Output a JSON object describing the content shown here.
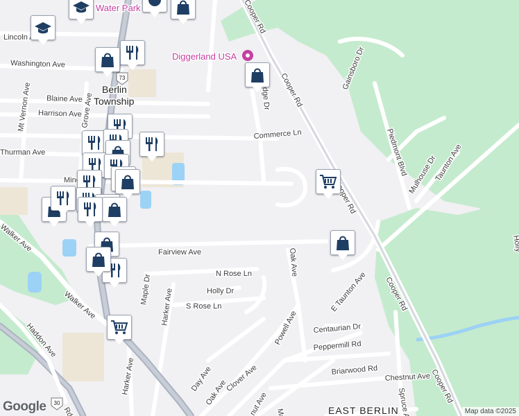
{
  "map": {
    "water_park_label": "Water Park",
    "poi_diggerland": "Diggerland USA",
    "place_berlin": [
      "Berlin",
      "Township"
    ],
    "place_east_berlin": "EAST BERLIN",
    "route_73": "73",
    "route_30": "30",
    "streets": {
      "lincoln": "Lincoln Ave",
      "washington": "Washington Ave",
      "blaine": "Blaine Ave",
      "harrison": "Harrison Ave",
      "mt_vernon": "Mt Vernon Ave",
      "grove": "Grove Ave",
      "thurman": "Thurman Ave",
      "minc": "Minc",
      "walker1": "Walker Ave",
      "walker2": "Walker Ave",
      "haddon": "Haddon Ave",
      "fairview": "Fairview Ave",
      "n_rose": "N Rose Ln",
      "holly": "Holly Dr",
      "s_rose": "S Rose Ln",
      "maple": "Maple Dr",
      "harker1": "Harker Ave",
      "harker2": "Harker Ave",
      "oak1": "Oak Ave",
      "oak2": "Oak Ave",
      "powell": "Powell Ave",
      "day": "Day Ave",
      "clover": "Clover Ave",
      "chestnut_partial": "nut Ave",
      "ma_partial": "Ma",
      "commerce": "Commerce Ln",
      "edge_partial": "edge Dr",
      "cooper1": "Cooper Rd",
      "cooper2": "Cooper Rd",
      "cooper3": "Cooper Rd",
      "cooper4": "Cooper Rd",
      "cooper5": "Cooper Rd",
      "rd_partial": "Rd",
      "gainsboro": "Gainsboro Dr",
      "piedmont": "Piedmont Blvd",
      "mulhouse": "Mulhouse Dr",
      "taunton": "Taunton Ave",
      "e_taunton": "E Taunton Ave",
      "centaurian": "Centaurian Dr",
      "peppermill": "Peppermill Rd",
      "briarwood": "Briarwood Rd",
      "chestnut": "Chestnut Ave",
      "spruce": "Spruce A",
      "holly_partial": "Holly"
    },
    "attribution": "Map data ©2025",
    "logo": "Google"
  },
  "markers": [
    {
      "type": "school",
      "name": "school-marker"
    },
    {
      "type": "school",
      "name": "school-marker"
    },
    {
      "type": "poi",
      "name": "poi-marker"
    },
    {
      "type": "shopping",
      "name": "shopping-marker"
    },
    {
      "type": "restaurant",
      "name": "restaurant-marker"
    },
    {
      "type": "shopping",
      "name": "shopping-marker"
    },
    {
      "type": "shopping",
      "name": "shopping-marker"
    },
    {
      "type": "restaurant",
      "name": "restaurant-marker"
    },
    {
      "type": "restaurant",
      "name": "restaurant-marker"
    },
    {
      "type": "restaurant",
      "name": "restaurant-marker"
    },
    {
      "type": "restaurant",
      "name": "restaurant-marker"
    },
    {
      "type": "restaurant",
      "name": "restaurant-marker"
    },
    {
      "type": "shopping",
      "name": "shopping-marker"
    },
    {
      "type": "restaurant",
      "name": "restaurant-marker"
    },
    {
      "type": "restaurant",
      "name": "restaurant-marker"
    },
    {
      "type": "restaurant",
      "name": "restaurant-marker"
    },
    {
      "type": "shopping",
      "name": "shopping-marker"
    },
    {
      "type": "shopping",
      "name": "shopping-marker"
    },
    {
      "type": "restaurant",
      "name": "restaurant-marker"
    },
    {
      "type": "restaurant",
      "name": "restaurant-marker"
    },
    {
      "type": "restaurant",
      "name": "restaurant-marker"
    },
    {
      "type": "shopping",
      "name": "shopping-marker"
    },
    {
      "type": "restaurant",
      "name": "restaurant-marker"
    },
    {
      "type": "shopping",
      "name": "shopping-marker"
    },
    {
      "type": "restaurant",
      "name": "restaurant-marker"
    },
    {
      "type": "grocery",
      "name": "grocery-marker"
    },
    {
      "type": "grocery",
      "name": "grocery-marker"
    },
    {
      "type": "shopping",
      "name": "shopping-marker"
    },
    {
      "type": "shopping",
      "name": "shopping-marker"
    }
  ],
  "colors": {
    "park": "#c5ebce",
    "water": "#9cd2f5",
    "road": "#ffffff",
    "highway": "#aab3c2",
    "marker_icon": "#1f3e63"
  }
}
